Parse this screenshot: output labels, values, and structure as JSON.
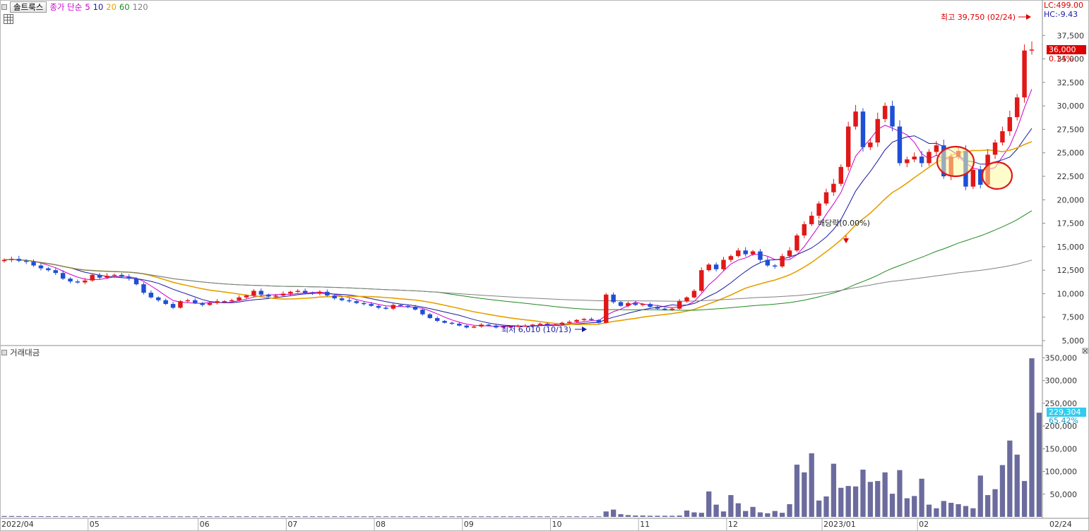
{
  "toolbar": {
    "stock_name": "솔트룩스",
    "ma_label": "종가 단순",
    "ma_periods": [
      {
        "label": "5",
        "color": "#cc00cc"
      },
      {
        "label": "10",
        "color": "#1a1aa0"
      },
      {
        "label": "20",
        "color": "#e6a000"
      },
      {
        "label": "60",
        "color": "#1f8a1f"
      },
      {
        "label": "120",
        "color": "#808080"
      }
    ]
  },
  "price_panel": {
    "lc": "LC:499.00",
    "hc": "HC:-9.43",
    "current_price": "36,000",
    "change_pct": "0.14%",
    "high_note": "최고 39,750 (02/24)",
    "low_note": "최저 6,010 (10/13)",
    "dividend_note": "배당락(0.00%)",
    "y_ticks": [
      "37,500",
      "35,000",
      "32,500",
      "30,000",
      "27,500",
      "25,000",
      "22,500",
      "20,000",
      "17,500",
      "15,000",
      "12,500",
      "10,000",
      "7,500",
      "5,000"
    ]
  },
  "volume_panel": {
    "title": "거래대금",
    "current_value": "229,304",
    "change_pct": "65.42%",
    "y_ticks": [
      "350,000",
      "300,000",
      "250,000",
      "200,000",
      "150,000",
      "100,000",
      "50,000"
    ]
  },
  "x_axis": {
    "labels": [
      "2022/04",
      "05",
      "06",
      "07",
      "08",
      "09",
      "10",
      "11",
      "12",
      "2023/01",
      "02"
    ],
    "end_label": "02/24"
  },
  "chart_data": {
    "type": "candlestick",
    "ylim": [
      5000,
      40000
    ],
    "volume_ylim": [
      0,
      360000
    ],
    "annotations": [
      {
        "text": "최고 39,750 (02/24)",
        "value": 39750
      },
      {
        "text": "최저 6,010 (10/13)",
        "value": 6010
      },
      {
        "text": "배당락(0.00%)"
      }
    ],
    "highlights": [
      "circled pullback candles early Feb",
      "circled pullback candles mid Feb"
    ],
    "close_path": [
      13600,
      13700,
      13500,
      13400,
      13000,
      12700,
      12500,
      12200,
      11600,
      11300,
      11200,
      11400,
      12000,
      11700,
      11900,
      12000,
      11800,
      11600,
      11000,
      10100,
      9600,
      9300,
      8900,
      8500,
      9200,
      9300,
      9000,
      8800,
      9000,
      9200,
      9200,
      9300,
      9600,
      9800,
      10300,
      9900,
      9700,
      9800,
      10000,
      10200,
      10300,
      10100,
      10000,
      10200,
      9800,
      9500,
      9300,
      9200,
      9000,
      8900,
      8700,
      8500,
      8400,
      8800,
      8700,
      8600,
      8300,
      7800,
      7400,
      7100,
      6900,
      6800,
      6600,
      6400,
      6500,
      6700,
      6600,
      6400,
      6500,
      6500,
      6600,
      6600,
      6700,
      6800,
      6700,
      6700,
      6900,
      7000,
      7200,
      7300,
      7200,
      6900,
      9900,
      9100,
      8700,
      9000,
      8800,
      8900,
      8600,
      8400,
      8300,
      8400,
      9200,
      9600,
      10300,
      12500,
      13100,
      12600,
      13600,
      14000,
      14600,
      14200,
      14500,
      13600,
      13000,
      12900,
      14000,
      14600,
      16200,
      17400,
      18300,
      19600,
      20800,
      21700,
      23500,
      27800,
      29400,
      25600,
      26100,
      28600,
      30000,
      27800,
      23900,
      24300,
      24600,
      23900,
      25100,
      25800,
      22500,
      24600,
      25200,
      21400,
      23200,
      21600,
      24800,
      26100,
      27300,
      28800,
      30900,
      35900,
      36000
    ],
    "series": [
      {
        "name": "5"
      },
      {
        "name": "10"
      },
      {
        "name": "20"
      },
      {
        "name": "60"
      },
      {
        "name": "120"
      }
    ],
    "volume_path": [
      2000,
      2000,
      1800,
      1800,
      1600,
      1600,
      1500,
      1500,
      1500,
      1400,
      1400,
      1400,
      1400,
      1300,
      1300,
      1300,
      1300,
      1300,
      1300,
      1300,
      1300,
      1300,
      1300,
      1300,
      1300,
      1300,
      1300,
      1300,
      1300,
      1300,
      1300,
      1300,
      1300,
      1300,
      1300,
      1300,
      1300,
      1300,
      1300,
      1300,
      1300,
      1300,
      1300,
      1300,
      1300,
      1300,
      1300,
      1300,
      1300,
      1300,
      1300,
      1300,
      1300,
      1300,
      1300,
      1300,
      1300,
      1300,
      1300,
      1300,
      1300,
      1300,
      1300,
      1300,
      1300,
      1300,
      1300,
      1300,
      1300,
      1300,
      1300,
      1300,
      1300,
      1300,
      1300,
      1300,
      1300,
      1300,
      1300,
      1300,
      1300,
      1300,
      12000,
      16000,
      6000,
      4000,
      3000,
      3000,
      2500,
      2500,
      2500,
      2500,
      3000,
      14000,
      10000,
      9000,
      56000,
      27000,
      12000,
      48000,
      30000,
      13000,
      22000,
      10000,
      8000,
      13000,
      9000,
      28000,
      115000,
      98000,
      140000,
      36000,
      45000,
      117000,
      64000,
      68000,
      67000,
      104000,
      77000,
      79000,
      98000,
      51000,
      103000,
      41000,
      46000,
      84000,
      27000,
      19000,
      35000,
      31000,
      28000,
      24000,
      19000,
      91000,
      48000,
      61000,
      114000,
      168000,
      137000,
      79000,
      349000,
      229304
    ]
  }
}
